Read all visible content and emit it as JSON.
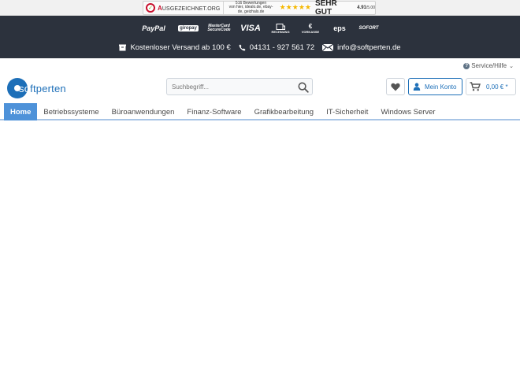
{
  "rating": {
    "brand_prefix": "A",
    "brand_rest": "USGEZEICHNET.ORG",
    "reviews_line1": "516 Bewertungen",
    "reviews_line2": "von hier, idealo.de, ebay-",
    "reviews_line3": "de, geizhals.de",
    "stars": "★★★★★",
    "verdict": "SEHR GUT",
    "score": "4.91",
    "score_max": "/5.00"
  },
  "payments": {
    "paypal": "PayPal",
    "giropay": "giropay",
    "mastercard_line1": "MasterCard",
    "mastercard_line2": "SecureCode",
    "visa": "VISA",
    "rechnung": "RECHNUNG",
    "vorkasse": "VORKASSE",
    "eps": "eps",
    "sofort": "SOFORT"
  },
  "info": {
    "shipping": "Kostenloser Versand ab 100 €",
    "phone": "04131 - 927 561 72",
    "email": "info@softperten.de"
  },
  "service": {
    "label": "Service/Hilfe"
  },
  "logo": {
    "part1": "so",
    "part2": "ftperten"
  },
  "search": {
    "placeholder": "Suchbegriff..."
  },
  "account": {
    "label": "Mein Konto"
  },
  "cart": {
    "label": "0,00 € *"
  },
  "nav": {
    "items": [
      {
        "label": "Home"
      },
      {
        "label": "Betriebssysteme"
      },
      {
        "label": "Büroanwendungen"
      },
      {
        "label": "Finanz-Software"
      },
      {
        "label": "Grafikbearbeitung"
      },
      {
        "label": "IT-Sicherheit"
      },
      {
        "label": "Windows Server"
      }
    ]
  },
  "colors": {
    "header_dark": "#2c323d",
    "brand_blue": "#1d6fb8",
    "nav_active": "#4e92d9",
    "star": "#f5b800"
  }
}
